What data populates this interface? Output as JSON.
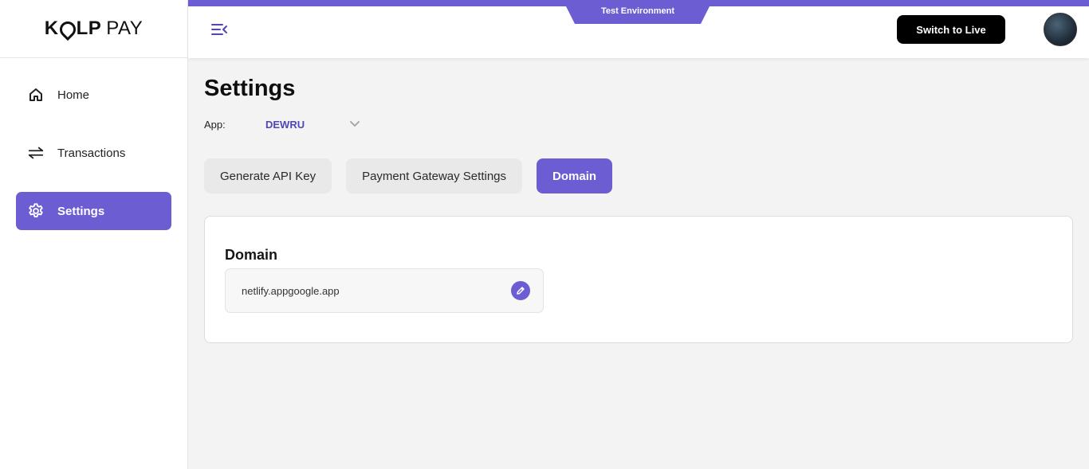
{
  "brand": {
    "logo_k": "K",
    "logo_lp": "LP",
    "logo_pay": "PAY"
  },
  "sidebar": {
    "items": [
      {
        "label": "Home",
        "icon": "home-icon"
      },
      {
        "label": "Transactions",
        "icon": "transfer-arrows-icon"
      },
      {
        "label": "Settings",
        "icon": "gear-icon",
        "active": true
      }
    ]
  },
  "header": {
    "environment_label": "Test Environment",
    "switch_label": "Switch to Live"
  },
  "page": {
    "title": "Settings",
    "app_label": "App:",
    "app_value": "DEWRU"
  },
  "tabs": [
    {
      "label": "Generate API Key"
    },
    {
      "label": "Payment Gateway Settings"
    },
    {
      "label": "Domain",
      "active": true
    }
  ],
  "domain_card": {
    "title": "Domain",
    "value": "netlify.appgoogle.app"
  },
  "colors": {
    "accent": "#6c5dd3",
    "background": "#f3f3f3",
    "button_dark": "#000000"
  }
}
